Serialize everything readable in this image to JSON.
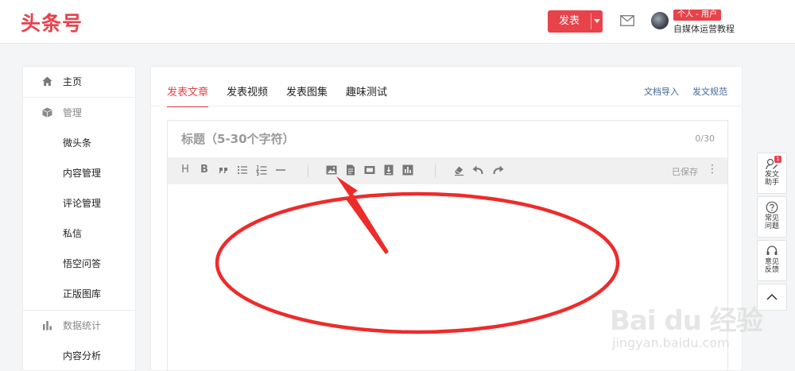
{
  "header": {
    "logo": "头条号",
    "publish_label": "发表",
    "user_badge": "个人 - 用户",
    "user_name": "自媒体运营教程"
  },
  "sidebar": {
    "items": [
      {
        "label": "主页",
        "icon": "home-icon"
      },
      {
        "label": "管理",
        "icon": "box-icon",
        "group": true
      },
      {
        "label": "微头条"
      },
      {
        "label": "内容管理"
      },
      {
        "label": "评论管理"
      },
      {
        "label": "私信"
      },
      {
        "label": "悟空问答"
      },
      {
        "label": "正版图库"
      },
      {
        "label": "数据统计",
        "icon": "bar-chart-icon",
        "group": true
      },
      {
        "label": "内容分析"
      }
    ]
  },
  "main": {
    "tabs": [
      "发表文章",
      "发表视频",
      "发表图集",
      "趣味测试"
    ],
    "active_tab": "发表文章",
    "links": [
      "文档导入",
      "发文规范"
    ],
    "title_placeholder": "标题（5-30个字符）",
    "counter": "0/30",
    "saved": "已保存"
  },
  "toolbar": {
    "tools": [
      "H",
      "B",
      "quote-icon",
      "bullet-list-icon",
      "numbered-list-icon",
      "divider-icon",
      "image-icon",
      "document-icon",
      "video-icon",
      "audio-icon",
      "chart-icon",
      "eraser-icon",
      "undo-icon",
      "redo-icon"
    ]
  },
  "floatbar": {
    "items": [
      {
        "label": "发文助手",
        "icon": "edit-icon",
        "badge": "1"
      },
      {
        "label": "常见问题",
        "icon": "question-icon"
      },
      {
        "label": "意见反馈",
        "icon": "headset-icon"
      },
      {
        "label": "",
        "icon": "chevron-up-icon"
      }
    ]
  },
  "watermark": {
    "brand": "Bai du 经验",
    "url": "jingyan.baidu.com"
  },
  "colors": {
    "accent": "#e8424a",
    "link": "#406599",
    "annotation": "#ee2b2b"
  }
}
